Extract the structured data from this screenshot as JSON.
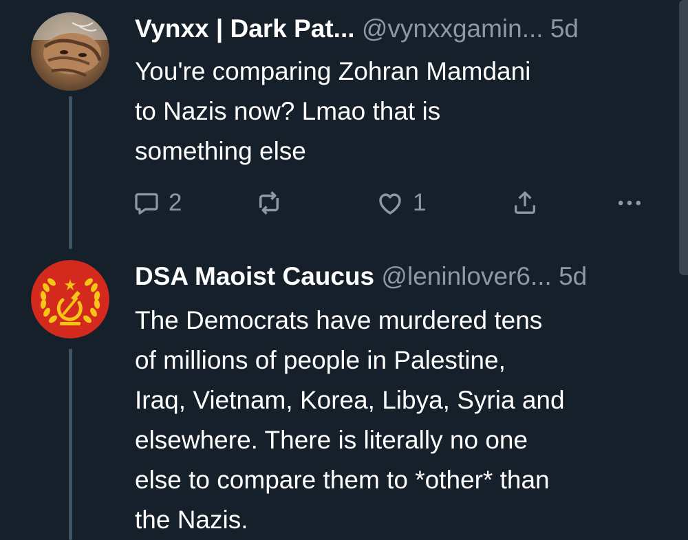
{
  "tweets": [
    {
      "display_name": "Vynxx | Dark Pat...",
      "handle": "@vynxxgamin...",
      "time": "5d",
      "text_lines": [
        "You're comparing Zohran Mamdani",
        "to Nazis now? Lmao that is",
        "something else"
      ],
      "reply_count": "2",
      "like_count": "1",
      "avatar": "cat-photo"
    },
    {
      "display_name": "DSA Maoist Caucus",
      "handle": "@leninlover6...",
      "time": "5d",
      "text_lines": [
        "The Democrats have murdered tens",
        "of millions of people in Palestine,",
        "Iraq, Vietnam, Korea, Libya, Syria and",
        "elsewhere. There is literally no one",
        "else to compare them to *other* than",
        "the Nazis."
      ],
      "avatar": "hammer-sickle-emblem"
    }
  ],
  "icons": {
    "reply": "reply-icon",
    "retweet": "retweet-icon",
    "like": "like-icon",
    "share": "share-icon",
    "more": "more-icon"
  },
  "colors": {
    "background": "#15202b",
    "muted_text": "#8b98a5",
    "thread_line": "#3d5466",
    "emblem_red": "#d42a1e",
    "emblem_gold": "#f5c518"
  }
}
